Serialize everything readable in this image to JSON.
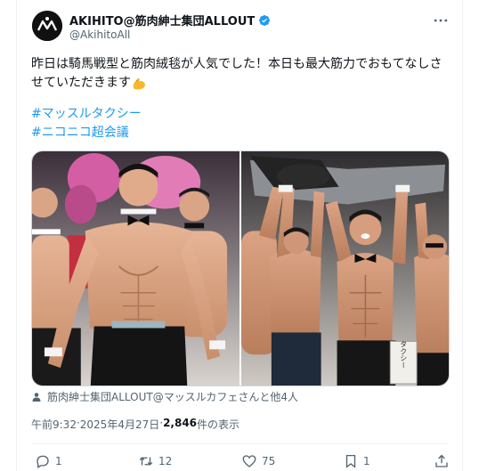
{
  "author": {
    "display_name": "AKIHITO@筋肉紳士集団ALLOUT",
    "handle": "@AkihitoAll",
    "verified": true
  },
  "tweet": {
    "line1": "昨日は騎馬戦型と筋肉絨毯が人気でした！本日も最大筋力でおもてなしさ",
    "line2": "せていただきます",
    "emoji": "flexed-biceps-icon",
    "hashtags": [
      "#マッスルタクシー",
      "#ニコニコ超会議"
    ]
  },
  "media": {
    "photos": [
      "photo-men-in-bowties",
      "photo-lifting-man"
    ],
    "sign_text": "タクシー"
  },
  "tagged": "筋肉紳士集団ALLOUT@マッスルカフェさんと他4人",
  "meta": {
    "time": "午前9:32",
    "separator": " · ",
    "date": "2025年4月27日",
    "views_count": "2,846",
    "views_label": " 件の表示"
  },
  "actions": {
    "replies": "1",
    "retweets": "12",
    "likes": "75",
    "bookmarks": "1"
  },
  "colors": {
    "link": "#1d9bf0",
    "secondary_text": "#536471",
    "verified": "#1d9bf0"
  }
}
